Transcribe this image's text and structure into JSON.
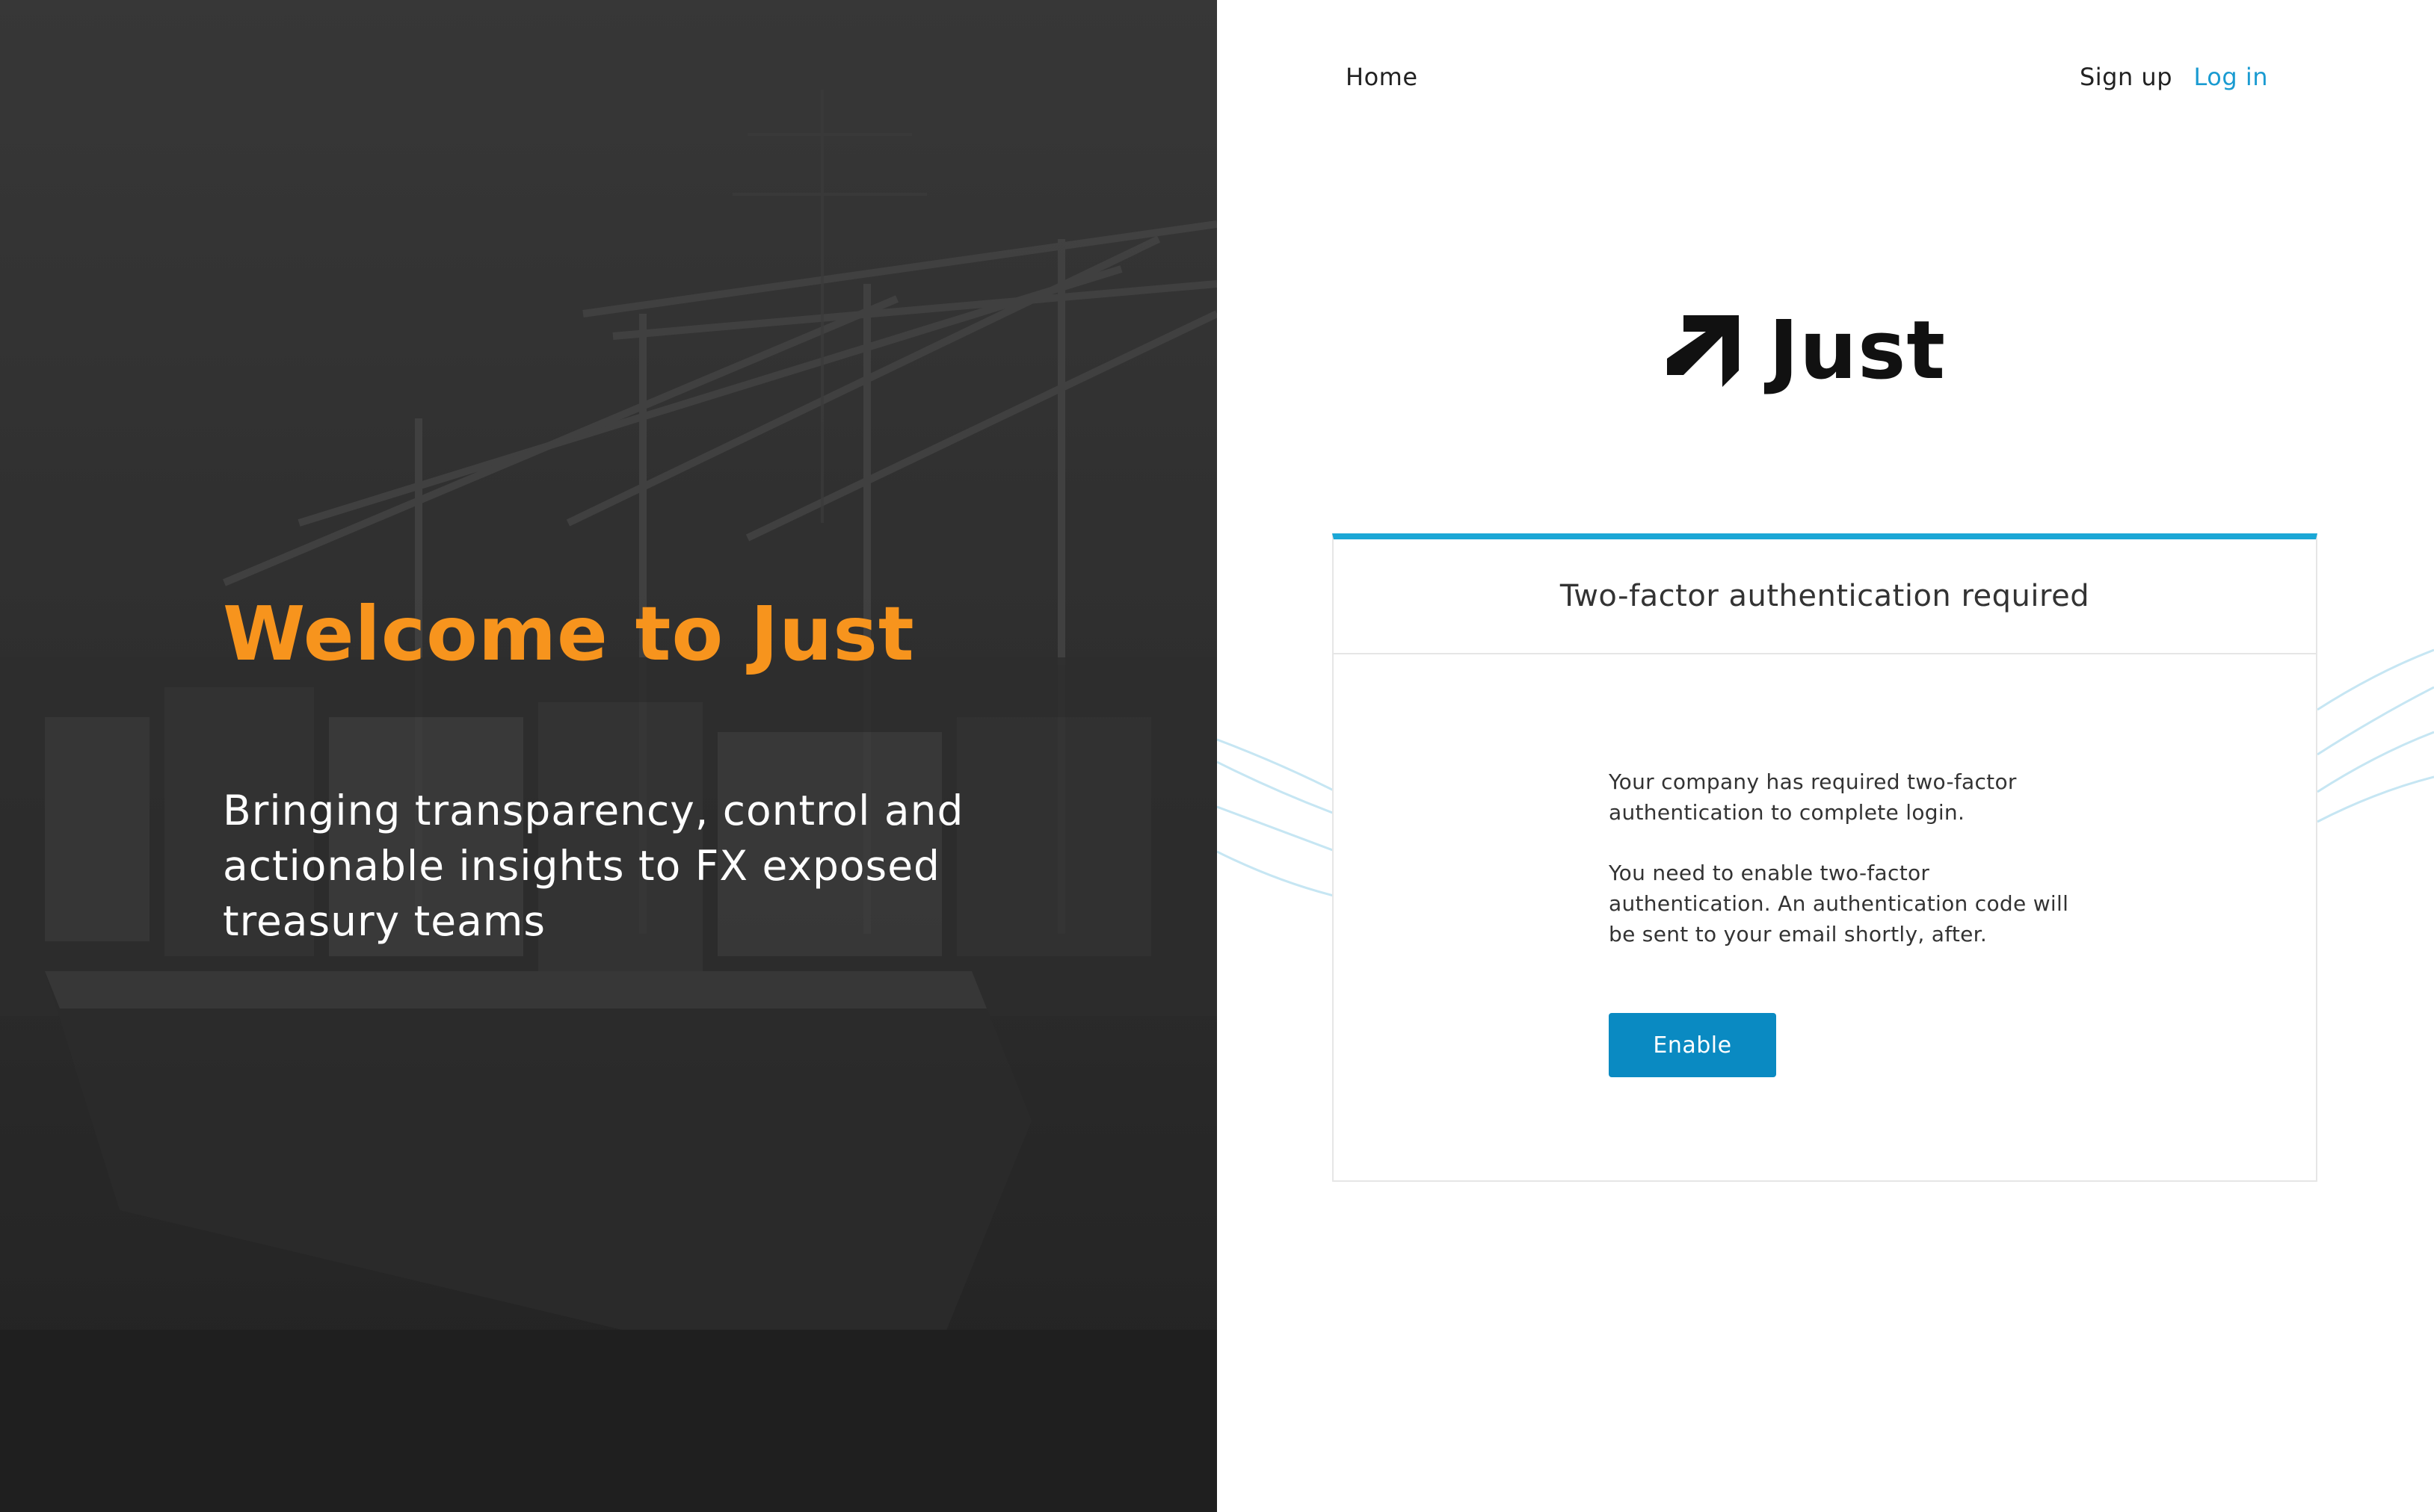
{
  "hero": {
    "title": "Welcome to Just",
    "subtitle": "Bringing transparency, control and actionable insights to FX exposed treasury teams"
  },
  "nav": {
    "home": "Home",
    "signup": "Sign up",
    "login": "Log in"
  },
  "brand": {
    "name": "Just"
  },
  "card": {
    "title": "Two-factor authentication required",
    "message_1": "Your company has required two-factor authentication to complete login.",
    "message_2": "You need to enable two-factor authentication. An authentication code will be sent to your email shortly, after.",
    "button_label": "Enable"
  },
  "colors": {
    "accent_orange": "#f7941d",
    "accent_blue": "#1ba7d6",
    "button_blue": "#0a8ac2",
    "link_blue": "#1a9bd1"
  }
}
